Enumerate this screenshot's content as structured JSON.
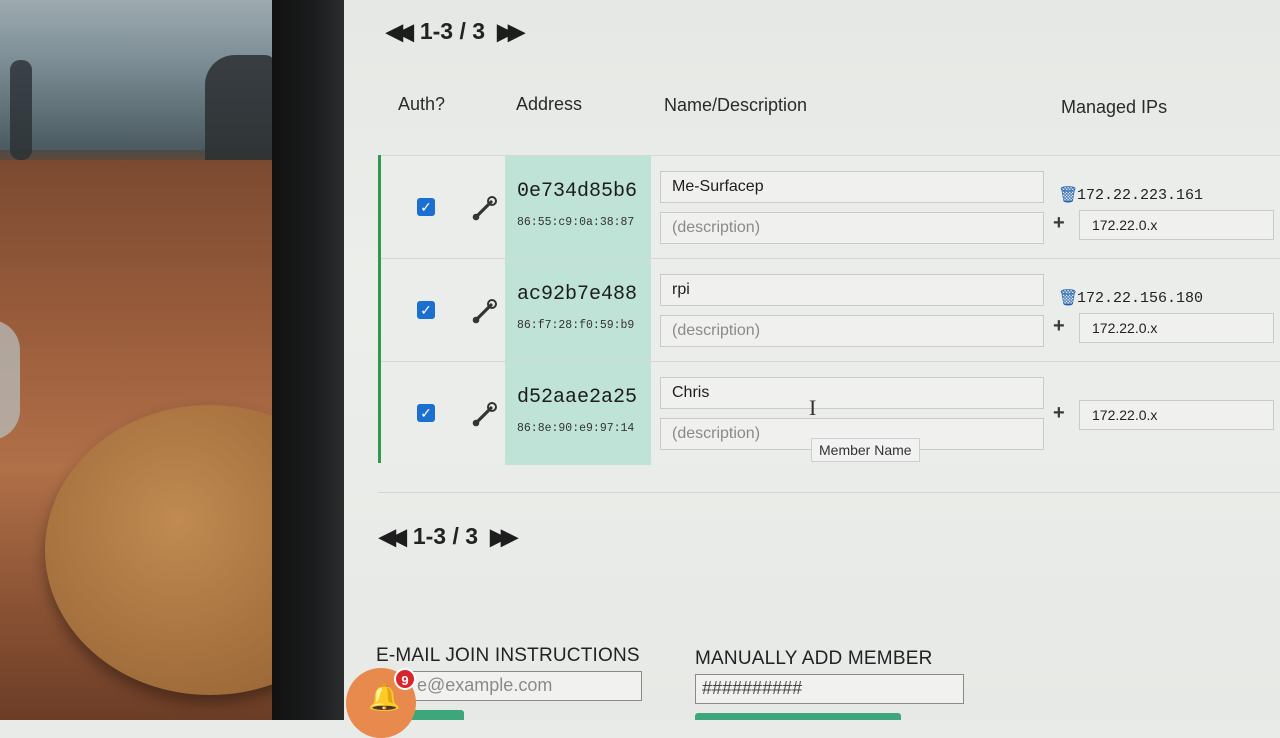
{
  "pager_top": {
    "count": "1-3 / 3"
  },
  "pager_bottom": {
    "count": "1-3 / 3"
  },
  "columns": {
    "auth": "Auth?",
    "address": "Address",
    "name": "Name/Description",
    "managed_ips": "Managed IPs"
  },
  "members": [
    {
      "authorized": true,
      "id": "0e734d85b6",
      "mac": "86:55:c9:0a:38:87",
      "name": "Me-Surfacep",
      "description_placeholder": "(description)",
      "ip": "172.22.223.161",
      "ip_placeholder": "172.22.0.x"
    },
    {
      "authorized": true,
      "id": "ac92b7e488",
      "mac": "86:f7:28:f0:59:b9",
      "name": "rpi",
      "description_placeholder": "(description)",
      "ip": "172.22.156.180",
      "ip_placeholder": "172.22.0.x"
    },
    {
      "authorized": true,
      "id": "d52aae2a25",
      "mac": "86:8e:90:e9:97:14",
      "name": "Chris",
      "description_placeholder": "(description)",
      "ip": "",
      "ip_placeholder": "172.22.0.x"
    }
  ],
  "tooltip": "Member Name",
  "email_join": {
    "label": "E-MAIL JOIN INSTRUCTIONS",
    "placeholder": "e@example.com"
  },
  "manual_add": {
    "label": "MANUALLY ADD MEMBER",
    "placeholder": "##########"
  },
  "notifications": {
    "count": "9"
  },
  "colors": {
    "accent_green": "#2b9a4a",
    "address_bg": "#bfe3d6",
    "checkbox_blue": "#1a6fd0",
    "badge_red": "#d9262e"
  },
  "icons": [
    "first-page-icon",
    "last-page-icon",
    "wrench-icon",
    "trash-icon",
    "plus-icon",
    "bell-icon",
    "checkbox-checked-icon"
  ]
}
